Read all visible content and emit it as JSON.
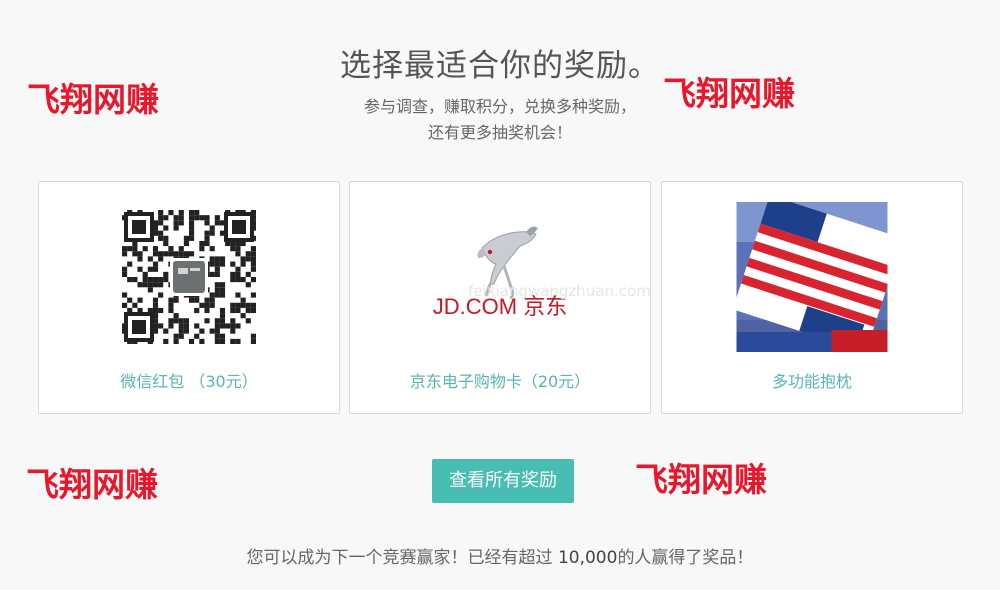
{
  "header": {
    "title": "选择最适合你的奖励。",
    "subtitle_line1": "参与调查，赚取积分，兑换多种奖励，",
    "subtitle_line2": "还有更多抽奖机会！"
  },
  "watermark": "飞翔网赚",
  "rewards": [
    {
      "label": "微信红包 （30元）",
      "icon": "wechat-qr-code"
    },
    {
      "label": "京东电子购物卡（20元）",
      "icon": "jd-logo",
      "logo_text": "JD.COM 京东"
    },
    {
      "label": "多功能抱枕",
      "icon": "pillow-blanket-photo"
    }
  ],
  "ghost_text": "feixiangwangzhuan.com",
  "cta": {
    "label": "查看所有奖励"
  },
  "footer": {
    "prefix": "您可以成为下一个竞赛赢家！已经有超过 ",
    "count": "10,000",
    "suffix": "的人赢得了奖品！"
  },
  "colors": {
    "accent": "#47bdb3",
    "label": "#5ab4b0",
    "watermark": "#e8172c",
    "jd_red": "#c81623"
  }
}
